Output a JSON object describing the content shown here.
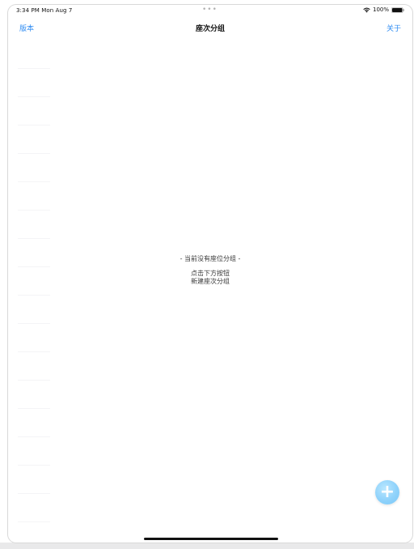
{
  "status_bar": {
    "time_date": "3:34 PM  Mon Aug 7",
    "center_dots": "•••",
    "battery_percent": "100%"
  },
  "nav": {
    "left_label": "版本",
    "title": "座次分组",
    "right_label": "关于"
  },
  "empty_state": {
    "title": "- 当前没有座位分组 -",
    "line1": "点击下方按钮",
    "line2": "新建座次分组"
  },
  "fab": {
    "label": "+"
  },
  "colors": {
    "accent": "#2f8cf2",
    "fab": "#8fd2fb"
  },
  "icons": {
    "wifi": "wifi-icon",
    "battery": "battery-icon",
    "add": "plus-icon"
  }
}
